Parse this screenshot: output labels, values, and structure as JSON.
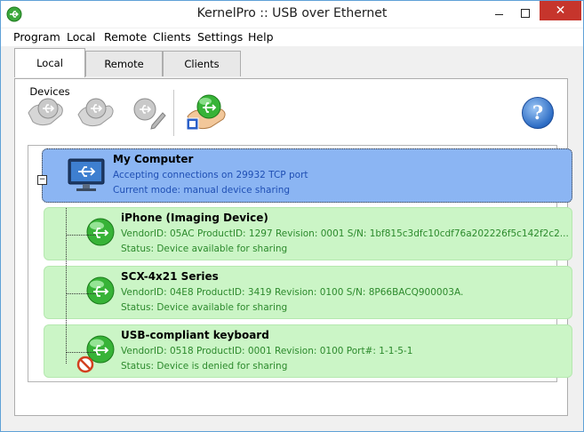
{
  "window": {
    "title": "KernelPro :: USB over Ethernet",
    "close_glyph": "✕"
  },
  "menu": {
    "items": [
      "Program",
      "Local",
      "Remote",
      "Clients",
      "Settings",
      "Help"
    ]
  },
  "tabs": [
    "Local Devices",
    "Remote Devices",
    "Clients"
  ],
  "toolbar": {
    "buttons": [
      {
        "icon": "share-device-icon",
        "enabled": false
      },
      {
        "icon": "unshare-device-icon",
        "enabled": false
      },
      {
        "icon": "edit-device-icon",
        "enabled": false
      },
      {
        "icon": "connect-remote-icon",
        "enabled": true
      }
    ],
    "help_glyph": "?"
  },
  "tree": {
    "computer": {
      "name": "My Computer",
      "line1": "Accepting connections on 29932 TCP port",
      "line2": "Current mode: manual device sharing",
      "collapse_glyph": "−"
    },
    "devices": [
      {
        "name": "iPhone (Imaging Device)",
        "line1": "VendorID: 05AC   ProductID: 1297   Revision: 0001   S/N: 1bf815c3dfc10cdf76a202226f5c142f2c2...",
        "line2": "Status: Device available for sharing",
        "denied": false
      },
      {
        "name": "SCX-4x21 Series",
        "line1": "VendorID: 04E8   ProductID: 3419   Revision: 0100   S/N: 8P66BACQ900003A.",
        "line2": "Status: Device available for sharing",
        "denied": false
      },
      {
        "name": "USB-compliant keyboard",
        "line1": "VendorID: 0518   ProductID: 0001   Revision: 0100   Port#: 1-1-5-1",
        "line2": "Status: Device is denied for sharing",
        "denied": true
      }
    ]
  },
  "colors": {
    "computer_bg": "#8bb5f3",
    "device_bg": "#cbf5c6",
    "device_text": "#2c8a2c",
    "computer_text": "#1f4fb4",
    "close_red": "#c6352c"
  }
}
